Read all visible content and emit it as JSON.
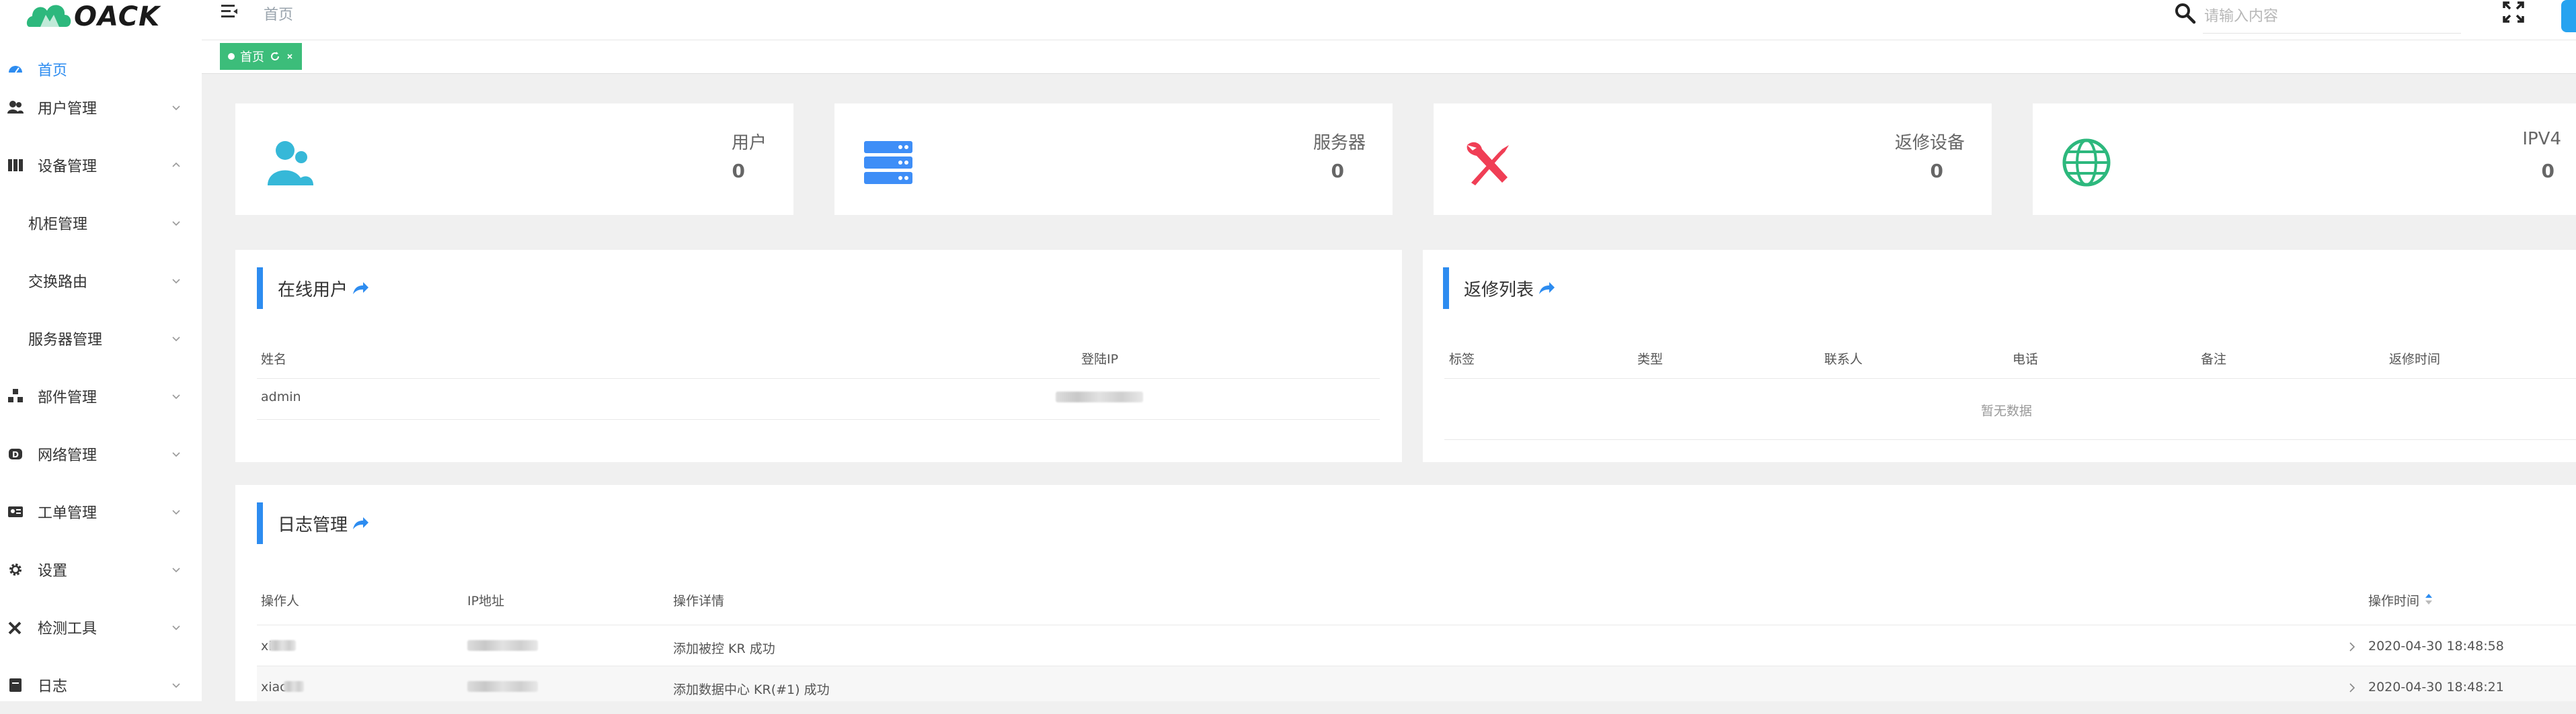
{
  "brand": {
    "logo_text": "OACK"
  },
  "header": {
    "breadcrumb": "首页",
    "search_placeholder": "请输入内容"
  },
  "tabs": [
    {
      "label": "首页"
    }
  ],
  "sidebar": {
    "items": [
      {
        "label": "首页",
        "icon": "dashboard-icon",
        "active": true
      },
      {
        "label": "用户管理",
        "icon": "users-icon"
      },
      {
        "label": "设备管理",
        "icon": "device-icon",
        "expanded": true
      },
      {
        "label": "机柜管理",
        "sub": true
      },
      {
        "label": "交换路由",
        "sub": true
      },
      {
        "label": "服务器管理",
        "sub": true
      },
      {
        "label": "部件管理",
        "icon": "parts-icon"
      },
      {
        "label": "网络管理",
        "icon": "network-icon"
      },
      {
        "label": "工单管理",
        "icon": "ticket-icon"
      },
      {
        "label": "设置",
        "icon": "gear-icon"
      },
      {
        "label": "检测工具",
        "icon": "tools-icon"
      },
      {
        "label": "日志",
        "icon": "log-icon"
      }
    ]
  },
  "stats": [
    {
      "label": "用户",
      "value": "0",
      "icon": "users-icon",
      "color": "#36b8d8"
    },
    {
      "label": "服务器",
      "value": "0",
      "icon": "server-icon",
      "color": "#3e8ef7"
    },
    {
      "label": "返修设备",
      "value": "0",
      "icon": "tools-icon",
      "color": "#f03e55"
    },
    {
      "label": "IPV4",
      "value": "0",
      "icon": "globe-icon",
      "color": "#2db87d"
    }
  ],
  "online_users": {
    "title": "在线用户",
    "columns": [
      "姓名",
      "登陆IP"
    ],
    "rows": [
      {
        "name": "admin"
      }
    ]
  },
  "repair_list": {
    "title": "返修列表",
    "columns": [
      "标签",
      "类型",
      "联系人",
      "电话",
      "备注",
      "返修时间"
    ],
    "empty_text": "暂无数据"
  },
  "logs": {
    "title": "日志管理",
    "columns": [
      "操作人",
      "IP地址",
      "操作详情",
      "操作时间"
    ],
    "rows": [
      {
        "user": "xi",
        "detail": "添加被控 KR 成功",
        "time": "2020-04-30 18:48:58"
      },
      {
        "user": "xiac",
        "detail": "添加数据中心 KR(#1) 成功",
        "time": "2020-04-30 18:48:21"
      }
    ]
  },
  "colors": {
    "accent": "#2d8cf0",
    "tab": "#3cbd7a"
  }
}
